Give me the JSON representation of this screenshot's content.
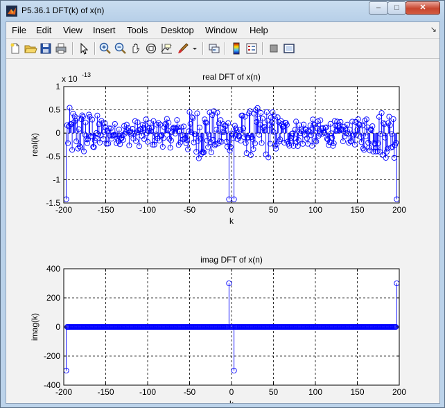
{
  "window": {
    "title": "P5.36.1 DFT(k) of x(n)",
    "min_label": "–",
    "max_label": "□",
    "close_label": "✕"
  },
  "menu": [
    "File",
    "Edit",
    "View",
    "Insert",
    "Tools",
    "Desktop",
    "Window",
    "Help"
  ],
  "menu_overflow": "↘",
  "toolbar": [
    "new-file-icon",
    "open-file-icon",
    "save-icon",
    "print-icon",
    "pointer-icon",
    "zoom-in-icon",
    "zoom-out-icon",
    "pan-hand-icon",
    "rotate-3d-icon",
    "data-cursor-icon",
    "brush-icon",
    "brush-dropdown-icon",
    "link-plot-icon",
    "colorbar-icon",
    "legend-icon",
    "hide-plot-tools-icon",
    "show-plot-tools-icon"
  ],
  "colors": {
    "series": "#0000ff",
    "grid": "#000000",
    "axes_bg": "#ffffff"
  },
  "chart_data": [
    {
      "type": "stem",
      "title": "real DFT of x(n)",
      "xlabel": "k",
      "ylabel": "real(k)",
      "exponent_label": "x 10",
      "exponent_power": "-13",
      "xlim": [
        -200,
        200
      ],
      "ylim": [
        -1.5,
        1
      ],
      "xticks": [
        "-200",
        "-150",
        "-100",
        "-50",
        "0",
        "50",
        "100",
        "150",
        "200"
      ],
      "yticks": [
        "-1.5",
        "-1",
        "-0.5",
        "0",
        "0.5",
        "1"
      ],
      "grid": "dashed",
      "marker": "circle",
      "k_range": [
        -197,
        197
      ],
      "notable_points": [
        {
          "k": -197,
          "value": -1.42
        },
        {
          "k": -3,
          "value": -1.42
        },
        {
          "k": 3,
          "value": -1.42
        },
        {
          "k": 197,
          "value": -1.42
        }
      ],
      "noise_envelope": {
        "k": [
          -200,
          -185,
          -165,
          -150,
          -140,
          -120,
          -100,
          -80,
          -60,
          -45,
          -30,
          -15,
          -5,
          5,
          15,
          30,
          45,
          60,
          80,
          100,
          120,
          140,
          150,
          165,
          185,
          200
        ],
        "amplitude": [
          0.55,
          0.55,
          0.45,
          0.3,
          0.22,
          0.28,
          0.3,
          0.3,
          0.35,
          0.55,
          0.55,
          0.45,
          0.4,
          0.4,
          0.45,
          0.55,
          0.55,
          0.35,
          0.3,
          0.3,
          0.28,
          0.22,
          0.3,
          0.45,
          0.55,
          0.55
        ]
      }
    },
    {
      "type": "stem",
      "title": "imag DFT of x(n)",
      "xlabel": "k",
      "ylabel": "imag(k)",
      "xlim": [
        -200,
        200
      ],
      "ylim": [
        -400,
        400
      ],
      "xticks": [
        "-200",
        "-150",
        "-100",
        "-50",
        "0",
        "50",
        "100",
        "150",
        "200"
      ],
      "yticks": [
        "-400",
        "-200",
        "0",
        "200",
        "400"
      ],
      "grid": "dashed",
      "marker": "circle",
      "k_range": [
        -197,
        197
      ],
      "baseline_value": 0,
      "nonzero_points": [
        {
          "k": -197,
          "value": -300
        },
        {
          "k": -3,
          "value": 300
        },
        {
          "k": 3,
          "value": -300
        },
        {
          "k": 197,
          "value": 300
        }
      ]
    }
  ]
}
